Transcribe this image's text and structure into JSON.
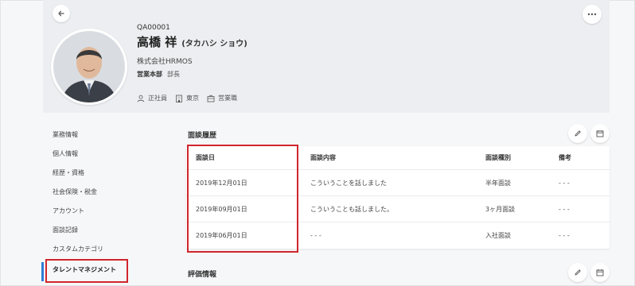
{
  "profile": {
    "employee_id": "QA00001",
    "name": "高橋 祥",
    "kana": "(タカハシ ショウ)",
    "company": "株式会社HRMOS",
    "department": "営業本部",
    "position": "部長",
    "tags": [
      {
        "icon": "person-icon",
        "label": "正社員"
      },
      {
        "icon": "building-icon",
        "label": "東京"
      },
      {
        "icon": "briefcase-icon",
        "label": "営業職"
      }
    ]
  },
  "sidebar": {
    "items": [
      {
        "label": "業務情報"
      },
      {
        "label": "個人情報"
      },
      {
        "label": "経歴・資格"
      },
      {
        "label": "社会保険・税金"
      },
      {
        "label": "アカウント"
      },
      {
        "label": "面談記録"
      },
      {
        "label": "カスタムカテゴリ"
      },
      {
        "label": "タレントマネジメント"
      }
    ]
  },
  "interviews": {
    "title": "面談履歴",
    "columns": [
      "面談日",
      "面談内容",
      "面談種別",
      "備考"
    ],
    "rows": [
      {
        "date": "2019年12月01日",
        "content": "こういうことを話しました",
        "type": "半年面談",
        "note": "- - -"
      },
      {
        "date": "2019年09月01日",
        "content": "こういうことも話しました。",
        "type": "3ヶ月面談",
        "note": "- - -"
      },
      {
        "date": "2019年06月01日",
        "content": "- - -",
        "type": "入社面談",
        "note": "- - -"
      }
    ]
  },
  "evaluation": {
    "title": "評価情報"
  },
  "colors": {
    "accent": "#2f7bd6",
    "highlight": "#d0262d",
    "header_bg": "#eceef1"
  }
}
